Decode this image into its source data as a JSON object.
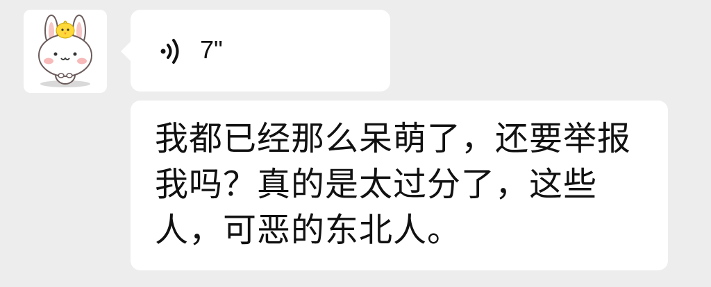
{
  "conversation": {
    "voice_message": {
      "duration": "7\"",
      "icon": "voice-wave-icon"
    },
    "text_message": {
      "content": "我都已经那么呆萌了，还要举报我吗？真的是太过分了，这些人，可恶的东北人。"
    },
    "sender_avatar": {
      "icon": "bunny-with-chick-avatar"
    }
  }
}
